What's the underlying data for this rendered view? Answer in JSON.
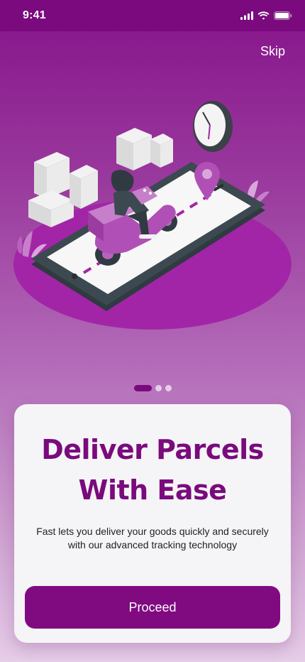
{
  "status_bar": {
    "time": "9:41"
  },
  "header": {
    "skip_label": "Skip"
  },
  "onboarding": {
    "title_line1": "Deliver Parcels",
    "title_line2": "With Ease",
    "description_line1": "Fast lets you deliver your goods quickly and securely",
    "description_line2": "with our advanced tracking technology",
    "proceed_label": "Proceed",
    "page_count": 3,
    "active_page": 1
  },
  "illustration": {
    "subject": "delivery-scooter-on-phone",
    "icons": [
      "clock-icon",
      "location-pin-icon",
      "parcel-boxes-icon",
      "plant-icon"
    ]
  },
  "colors": {
    "primary": "#800a80",
    "title": "#7a0a7d",
    "card_background": "#f5f4f6",
    "status_bar": "#7a0a7d"
  }
}
